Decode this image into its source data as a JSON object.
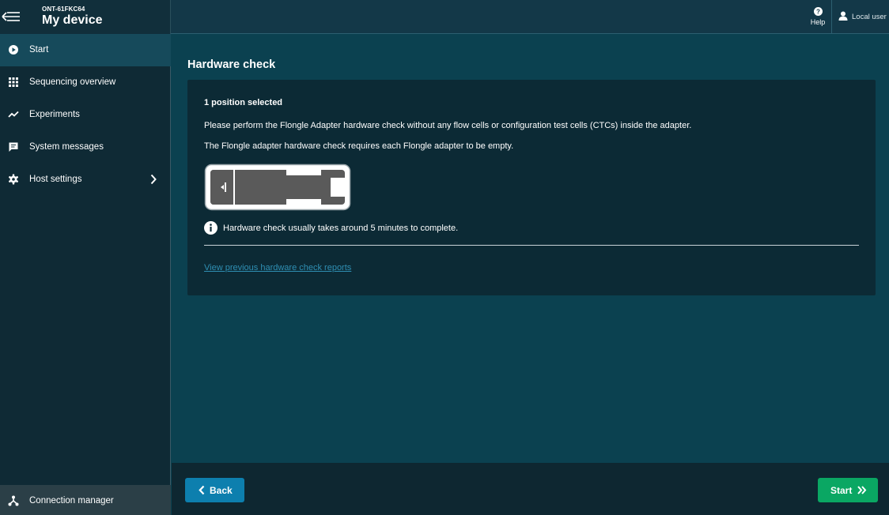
{
  "header": {
    "device_id": "ONT-61FKC64",
    "device_title": "My device",
    "help_label": "Help",
    "user_label": "Local user"
  },
  "sidebar": {
    "items": [
      {
        "label": "Start",
        "icon": "play-circle-icon",
        "active": true
      },
      {
        "label": "Sequencing overview",
        "icon": "grid-icon"
      },
      {
        "label": "Experiments",
        "icon": "trend-line-icon"
      },
      {
        "label": "System messages",
        "icon": "message-icon"
      },
      {
        "label": "Host settings",
        "icon": "gear-icon",
        "has_submenu": true
      }
    ],
    "footer_item": {
      "label": "Connection manager",
      "icon": "network-icon"
    }
  },
  "main": {
    "title": "Hardware check",
    "card": {
      "positions_selected": "1 position selected",
      "instruction_1": "Please perform the Flongle Adapter hardware check without any flow cells or configuration test cells (CTCs) inside the adapter.",
      "instruction_2": "The Flongle adapter hardware check requires each Flongle adapter to be empty.",
      "info_text": "Hardware check usually takes around 5 minutes to complete.",
      "reports_link": "View previous hardware check reports"
    }
  },
  "footer": {
    "back_label": "Back",
    "start_label": "Start"
  },
  "colors": {
    "primary_button": "#0d7fae",
    "start_button": "#0aa763",
    "link": "#2f8fb3",
    "background": "#0b4150"
  }
}
